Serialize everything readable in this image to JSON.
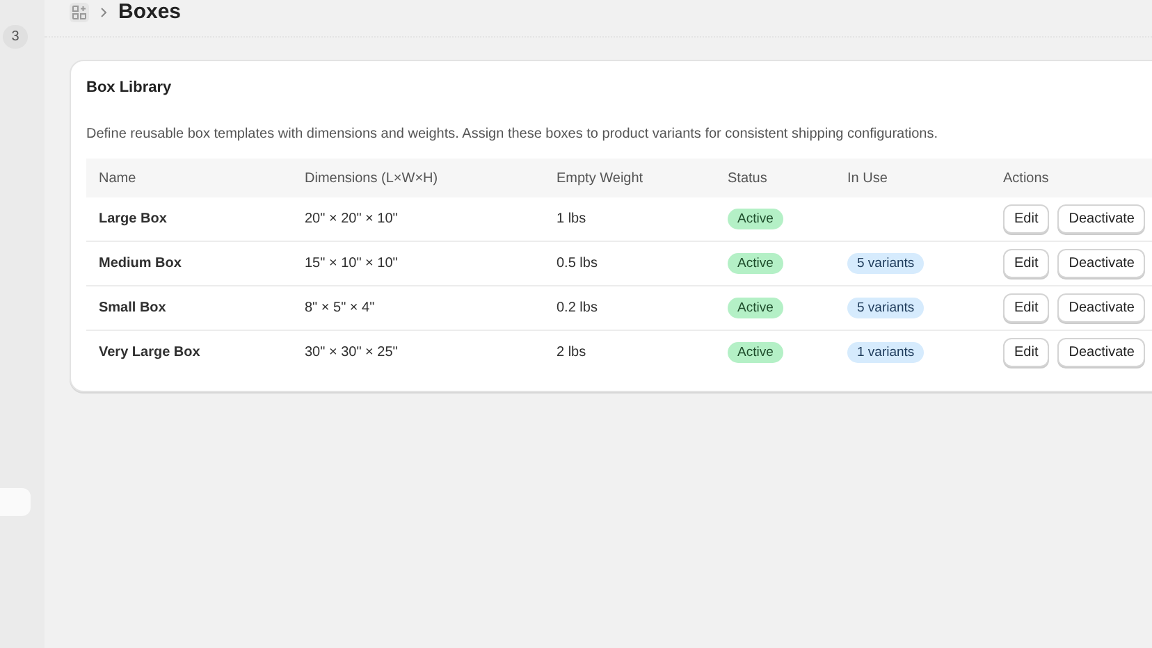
{
  "sidebar": {
    "badge": "3"
  },
  "breadcrumb": {
    "title": "Boxes"
  },
  "card": {
    "title": "Box Library",
    "description": "Define reusable box templates with dimensions and weights. Assign these boxes to product variants for consistent shipping configurations.",
    "table": {
      "columns": [
        "Name",
        "Dimensions (L×W×H)",
        "Empty Weight",
        "Status",
        "In Use",
        "Actions"
      ],
      "rows": [
        {
          "name": "Large Box",
          "dimensions": "20\" × 20\" × 10\"",
          "weight": "1 lbs",
          "status": "Active",
          "actions": [
            "Edit",
            "Deactivate"
          ]
        },
        {
          "name": "Medium Box",
          "dimensions": "15\" × 10\" × 10\"",
          "weight": "0.5 lbs",
          "status": "Active",
          "in_use": "5 variants",
          "actions": [
            "Edit",
            "Deactivate"
          ]
        },
        {
          "name": "Small Box",
          "dimensions": "8\" × 5\" × 4\"",
          "weight": "0.2 lbs",
          "status": "Active",
          "in_use": "5 variants",
          "actions": [
            "Edit",
            "Deactivate"
          ]
        },
        {
          "name": "Very Large Box",
          "dimensions": "30\" × 30\" × 25\"",
          "weight": "2 lbs",
          "status": "Active",
          "in_use": "1 variants",
          "actions": [
            "Edit",
            "Deactivate"
          ]
        }
      ]
    }
  }
}
